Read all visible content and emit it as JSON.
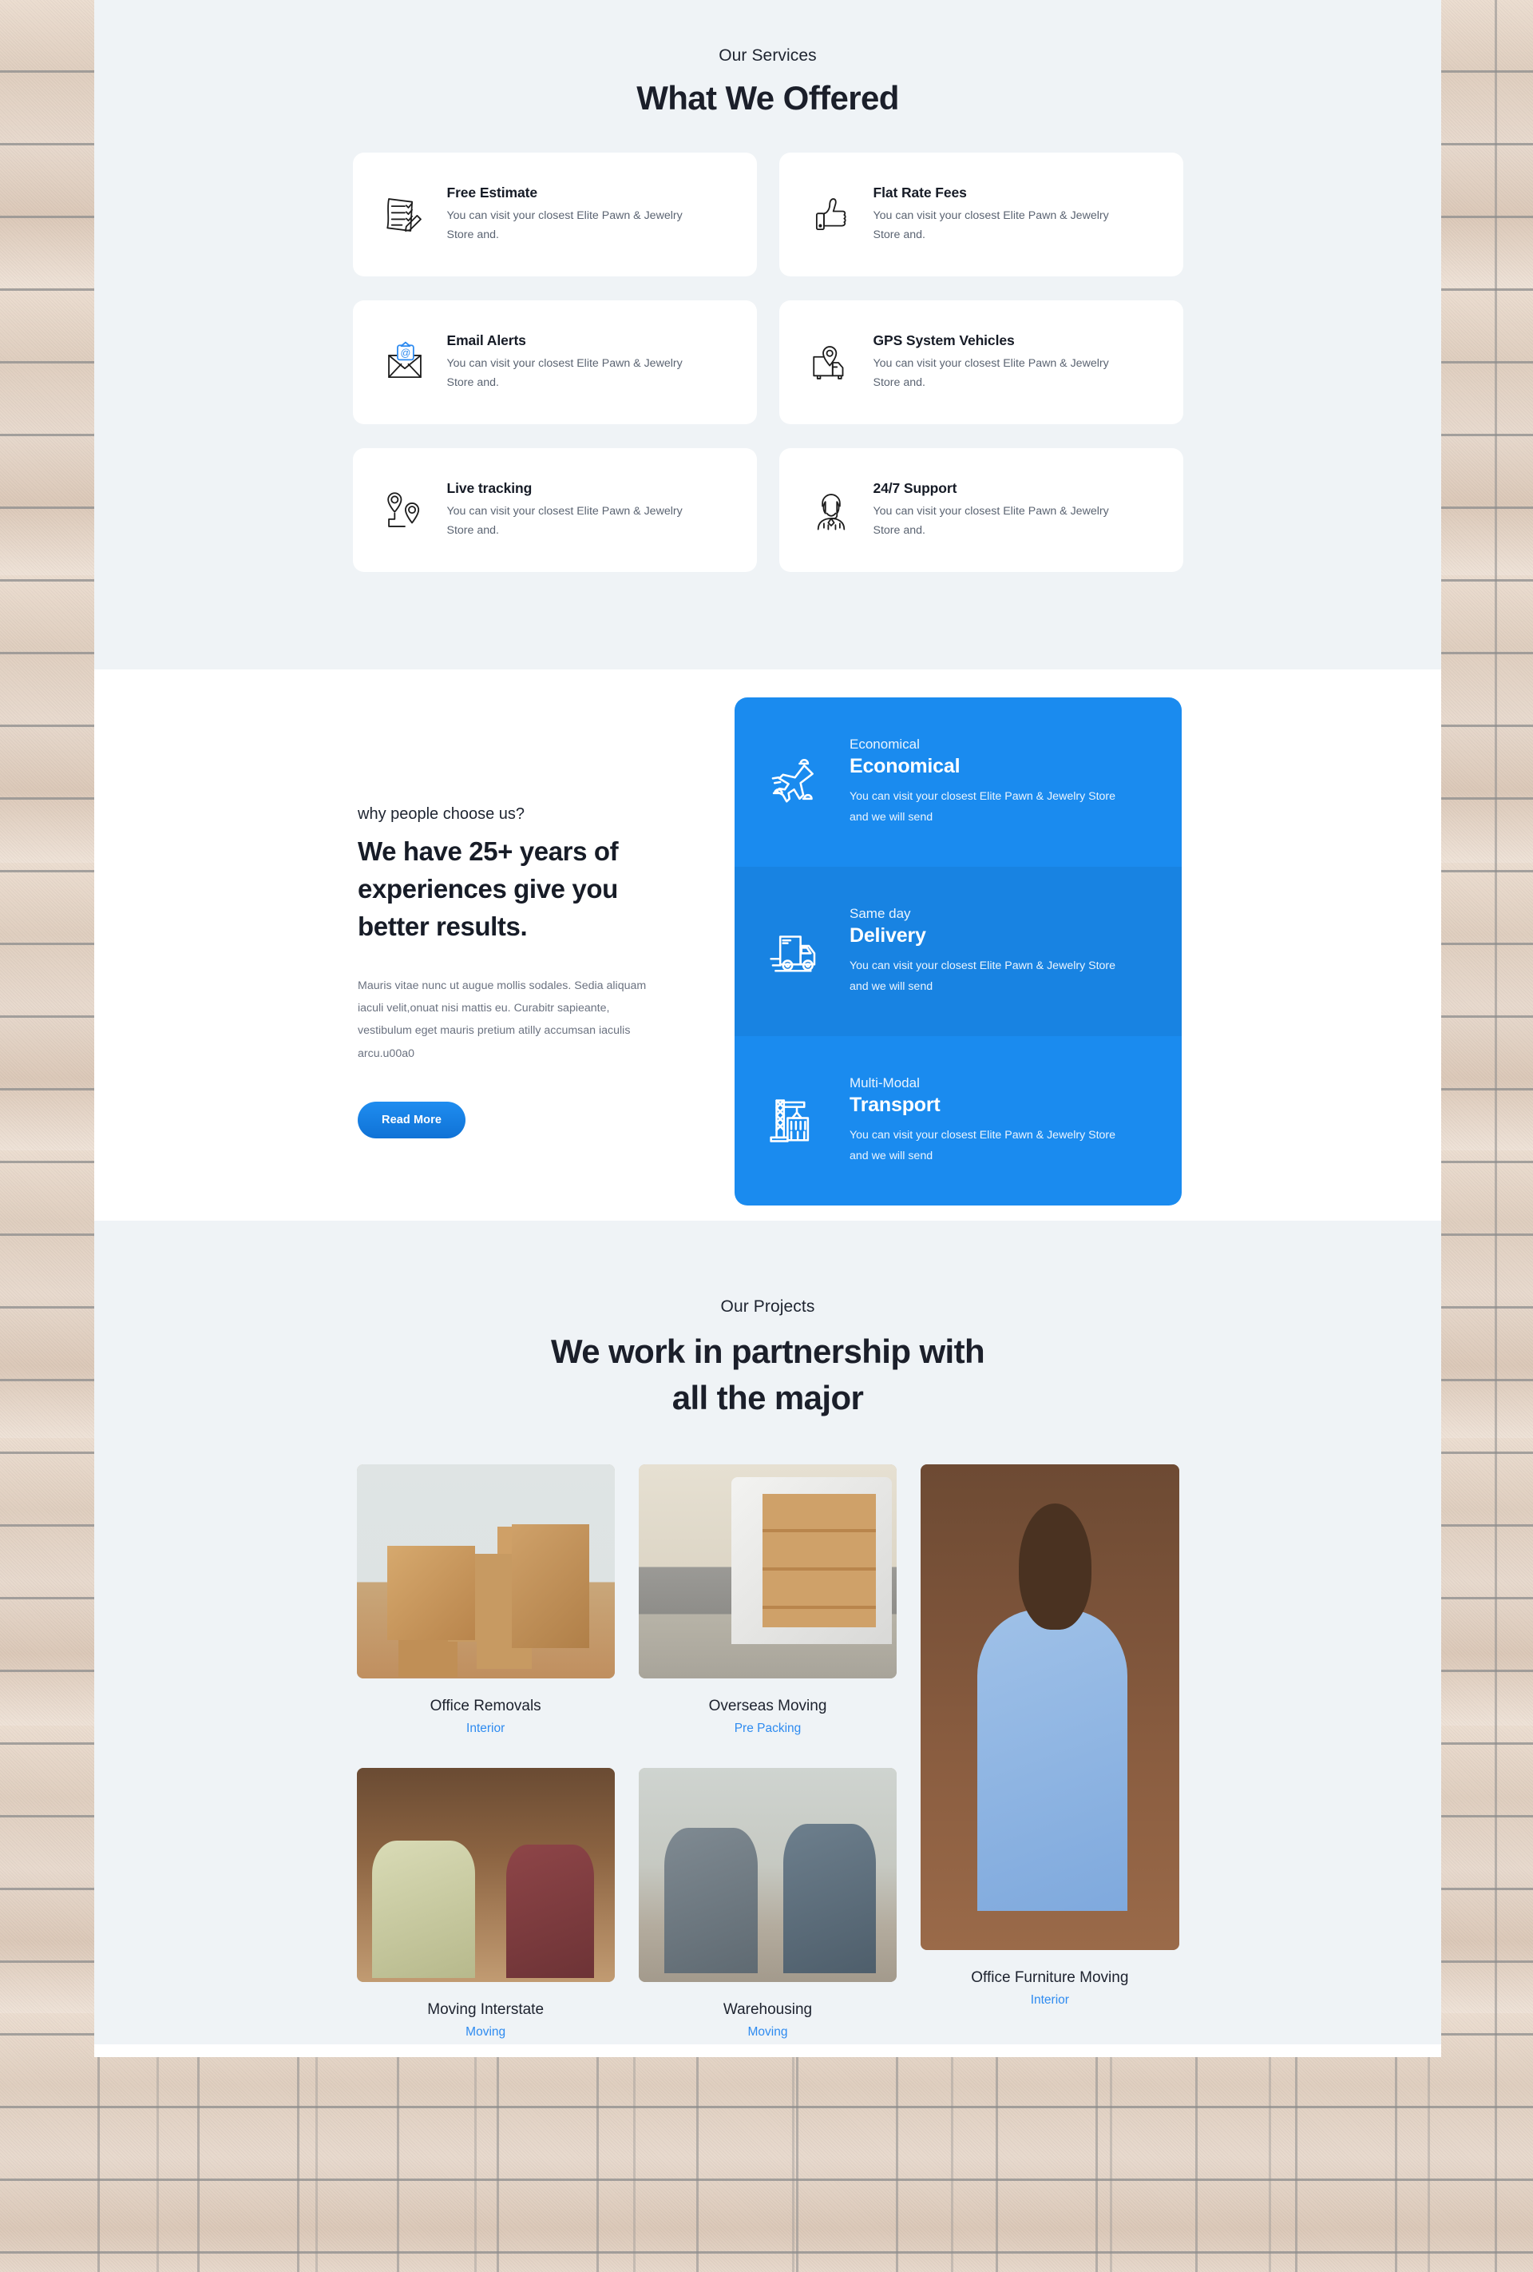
{
  "services_section": {
    "eyebrow": "Our Services",
    "title": "What We Offered",
    "cards": [
      {
        "icon": "checklist-pencil-icon",
        "title": "Free Estimate",
        "desc": "You can visit your closest Elite Pawn & Jewelry Store and."
      },
      {
        "icon": "thumbs-up-icon",
        "title": "Flat Rate Fees",
        "desc": "You can visit your closest Elite Pawn & Jewelry Store and."
      },
      {
        "icon": "email-envelope-icon",
        "title": "Email Alerts",
        "desc": "You can visit your closest Elite Pawn & Jewelry Store and."
      },
      {
        "icon": "gps-van-pin-icon",
        "title": "GPS System Vehicles",
        "desc": "You can visit your closest Elite Pawn & Jewelry Store and."
      },
      {
        "icon": "map-pins-icon",
        "title": "Live tracking",
        "desc": "You can visit your closest Elite Pawn & Jewelry Store and."
      },
      {
        "icon": "headset-agent-icon",
        "title": "24/7 Support",
        "desc": "You can visit your closest Elite Pawn & Jewelry Store and."
      }
    ]
  },
  "choose_section": {
    "eyebrow": "why people choose us?",
    "title": "We have 25+ years of experiences give you better results.",
    "body": "Mauris vitae nunc ut augue mollis sodales. Sedia aliquam iaculi velit,onuat nisi mattis eu. Curabitr sapieante, vestibulum eget mauris pretium atilly accumsan iaculis arcu.u00a0",
    "button_label": "Read More",
    "panel": [
      {
        "icon": "airplane-clouds-icon",
        "small": "Economical",
        "big": "Economical",
        "desc": "You can visit your closest Elite Pawn & Jewelry Store and we will send"
      },
      {
        "icon": "delivery-truck-icon",
        "small": "Same day",
        "big": "Delivery",
        "desc": "You can visit your closest Elite Pawn & Jewelry Store and we will send"
      },
      {
        "icon": "crane-container-icon",
        "small": "Multi-Modal",
        "big": "Transport",
        "desc": "You can visit your closest Elite Pawn & Jewelry Store and we will send"
      }
    ]
  },
  "projects_section": {
    "eyebrow": "Our Projects",
    "title_line1": "We work in partnership with",
    "title_line2": "all the major",
    "items": [
      {
        "name": "Office Removals",
        "tag": "Interior",
        "photo": "moving-boxes-in-room"
      },
      {
        "name": "Overseas Moving",
        "tag": "Pre Packing",
        "photo": "movers-loading-van"
      },
      {
        "name": "Office Furniture Moving",
        "tag": "Interior",
        "photo": "woman-packing-box"
      },
      {
        "name": "Moving Interstate",
        "tag": "Moving",
        "photo": "couple-carrying-boxes"
      },
      {
        "name": "Warehousing",
        "tag": "Moving",
        "photo": "men-packing-kitchen"
      }
    ]
  },
  "colors": {
    "accent_blue": "#1a8bef",
    "panel_alt_blue": "#1883e2",
    "section_bg": "#eff3f6",
    "heading": "#1b1f2a",
    "body_text": "#6b7280",
    "tag_blue": "#2e8bf0"
  }
}
